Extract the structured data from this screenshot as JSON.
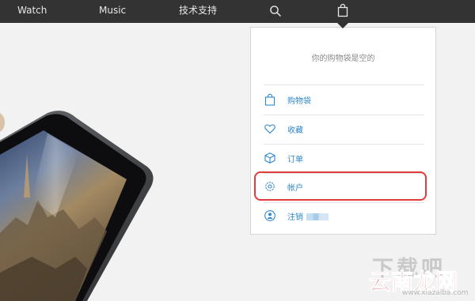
{
  "nav": {
    "watch": "Watch",
    "music": "Music",
    "support": "技术支持",
    "icons": {
      "search": "search-icon",
      "bag": "bag-icon"
    },
    "background": "#333333"
  },
  "bag_panel": {
    "empty_message": "你的购物袋是空的",
    "items": [
      {
        "label": "购物袋",
        "icon": "bag-icon"
      },
      {
        "label": "收藏",
        "icon": "heart-icon"
      },
      {
        "label": "订单",
        "icon": "box-icon"
      },
      {
        "label": "帐户",
        "icon": "gear-icon"
      },
      {
        "label": "注销",
        "icon": "user-icon"
      }
    ],
    "link_color": "#2f87c9",
    "highlight_color": "#e23b3b"
  },
  "watermark": {
    "line1": "下载吧",
    "line2": "云南龙网",
    "line3": "www.xiazaiba.com"
  }
}
